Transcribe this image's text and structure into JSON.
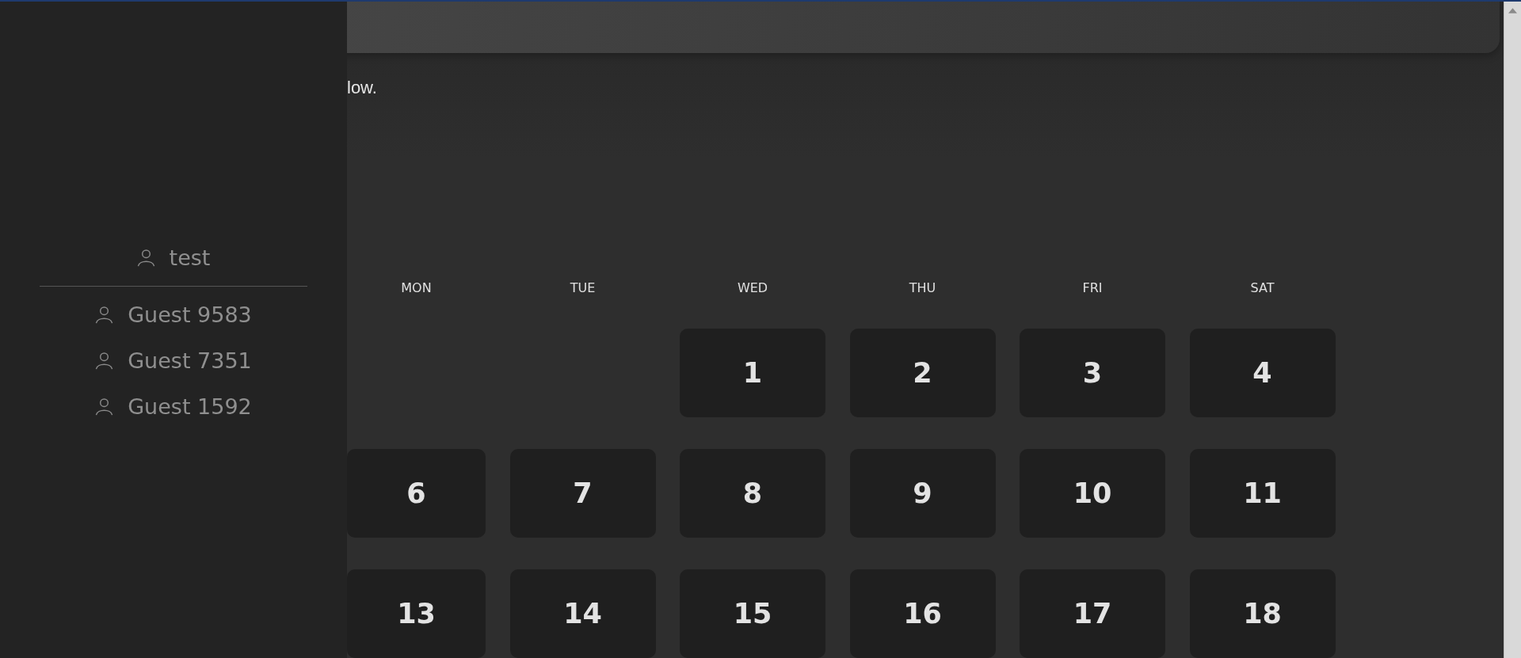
{
  "intro_text": "low.",
  "sidebar": {
    "current_user": "test",
    "guests": [
      {
        "name": "Guest 9583"
      },
      {
        "name": "Guest 7351"
      },
      {
        "name": "Guest 1592"
      }
    ]
  },
  "calendar": {
    "weekdays": [
      "MON",
      "TUE",
      "WED",
      "THU",
      "FRI",
      "SAT"
    ],
    "weeks": [
      {
        "kind": "first",
        "days": [
          "1",
          "2",
          "3",
          "4"
        ]
      },
      {
        "kind": "full",
        "days": [
          "6",
          "7",
          "8",
          "9",
          "10",
          "11"
        ]
      },
      {
        "kind": "full",
        "days": [
          "13",
          "14",
          "15",
          "16",
          "17",
          "18"
        ]
      }
    ]
  }
}
